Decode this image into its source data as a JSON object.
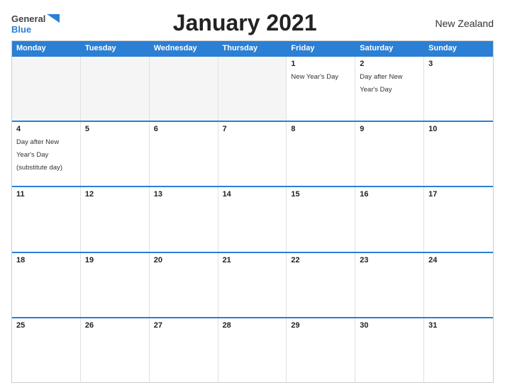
{
  "header": {
    "title": "January 2021",
    "country": "New Zealand",
    "logo_general": "General",
    "logo_blue": "Blue"
  },
  "calendar": {
    "days_of_week": [
      "Monday",
      "Tuesday",
      "Wednesday",
      "Thursday",
      "Friday",
      "Saturday",
      "Sunday"
    ],
    "weeks": [
      [
        {
          "day": "",
          "event": "",
          "empty": true
        },
        {
          "day": "",
          "event": "",
          "empty": true
        },
        {
          "day": "",
          "event": "",
          "empty": true
        },
        {
          "day": "",
          "event": "",
          "empty": true
        },
        {
          "day": "1",
          "event": "New Year's Day",
          "empty": false
        },
        {
          "day": "2",
          "event": "Day after New Year's Day",
          "empty": false
        },
        {
          "day": "3",
          "event": "",
          "empty": false
        }
      ],
      [
        {
          "day": "4",
          "event": "Day after New Year's Day (substitute day)",
          "empty": false
        },
        {
          "day": "5",
          "event": "",
          "empty": false
        },
        {
          "day": "6",
          "event": "",
          "empty": false
        },
        {
          "day": "7",
          "event": "",
          "empty": false
        },
        {
          "day": "8",
          "event": "",
          "empty": false
        },
        {
          "day": "9",
          "event": "",
          "empty": false
        },
        {
          "day": "10",
          "event": "",
          "empty": false
        }
      ],
      [
        {
          "day": "11",
          "event": "",
          "empty": false
        },
        {
          "day": "12",
          "event": "",
          "empty": false
        },
        {
          "day": "13",
          "event": "",
          "empty": false
        },
        {
          "day": "14",
          "event": "",
          "empty": false
        },
        {
          "day": "15",
          "event": "",
          "empty": false
        },
        {
          "day": "16",
          "event": "",
          "empty": false
        },
        {
          "day": "17",
          "event": "",
          "empty": false
        }
      ],
      [
        {
          "day": "18",
          "event": "",
          "empty": false
        },
        {
          "day": "19",
          "event": "",
          "empty": false
        },
        {
          "day": "20",
          "event": "",
          "empty": false
        },
        {
          "day": "21",
          "event": "",
          "empty": false
        },
        {
          "day": "22",
          "event": "",
          "empty": false
        },
        {
          "day": "23",
          "event": "",
          "empty": false
        },
        {
          "day": "24",
          "event": "",
          "empty": false
        }
      ],
      [
        {
          "day": "25",
          "event": "",
          "empty": false
        },
        {
          "day": "26",
          "event": "",
          "empty": false
        },
        {
          "day": "27",
          "event": "",
          "empty": false
        },
        {
          "day": "28",
          "event": "",
          "empty": false
        },
        {
          "day": "29",
          "event": "",
          "empty": false
        },
        {
          "day": "30",
          "event": "",
          "empty": false
        },
        {
          "day": "31",
          "event": "",
          "empty": false
        }
      ]
    ]
  },
  "colors": {
    "header_bg": "#2b7fd4",
    "header_text": "#ffffff",
    "accent": "#2b7fd4"
  }
}
